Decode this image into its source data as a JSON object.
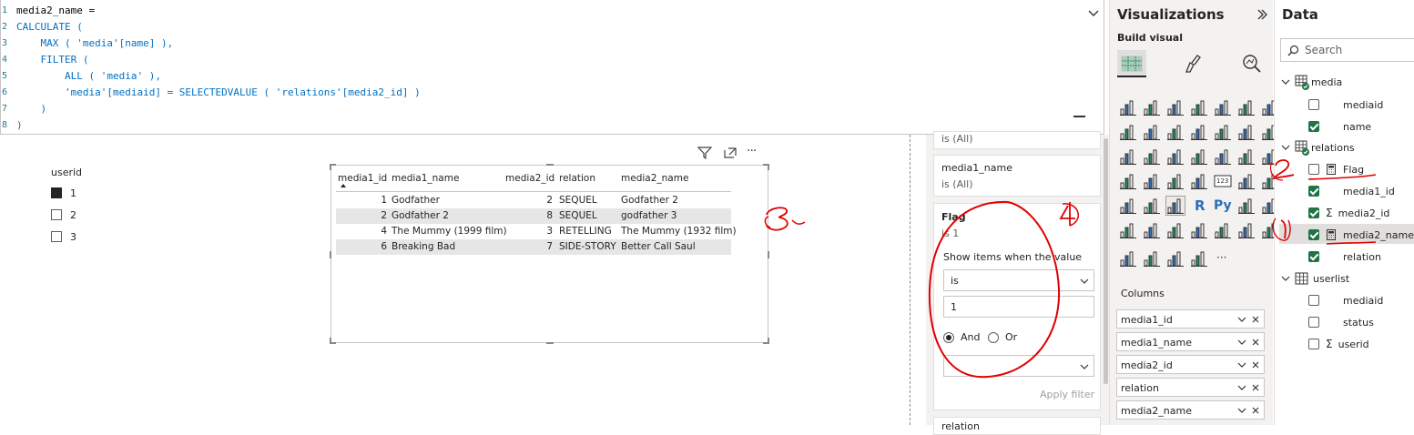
{
  "formula": {
    "lines": [
      {
        "n": "1",
        "text": "media2_name ="
      },
      {
        "n": "2",
        "text": "CALCULATE ("
      },
      {
        "n": "3",
        "text": "    MAX ( 'media'[name] ),"
      },
      {
        "n": "4",
        "text": "    FILTER ("
      },
      {
        "n": "5",
        "text": "        ALL ( 'media' ),"
      },
      {
        "n": "6",
        "text": "        'media'[mediaid] = SELECTEDVALUE ( 'relations'[media2_id] )"
      },
      {
        "n": "7",
        "text": "    )"
      },
      {
        "n": "8",
        "text": ")"
      }
    ]
  },
  "slicer": {
    "title": "userid",
    "items": [
      {
        "label": "1",
        "checked": true
      },
      {
        "label": "2",
        "checked": false
      },
      {
        "label": "3",
        "checked": false
      }
    ]
  },
  "table": {
    "headers": [
      "media1_id",
      "media1_name",
      "media2_id",
      "relation",
      "media2_name"
    ],
    "rows": [
      [
        "1",
        "Godfather",
        "2",
        "SEQUEL",
        "Godfather 2"
      ],
      [
        "2",
        "Godfather 2",
        "8",
        "SEQUEL",
        "godfather 3"
      ],
      [
        "4",
        "The Mummy (1999 film)",
        "3",
        "RETELLING",
        "The Mummy (1932 film)"
      ],
      [
        "6",
        "Breaking Bad",
        "7",
        "SIDE-STORY",
        "Better Call Saul"
      ]
    ]
  },
  "visual_tools": {
    "more": "···"
  },
  "filters": {
    "card_top_sub": "is (All)",
    "card_media1_title": "media1_name",
    "card_media1_sub": "is (All)",
    "flag_title": "Flag",
    "flag_sub": "is 1",
    "show_items_label": "Show items when the value",
    "condition": "is",
    "value": "1",
    "and_label": "And",
    "or_label": "Or",
    "apply_label": "Apply filter",
    "bottom_card_title": "relation"
  },
  "viz": {
    "title": "Visualizations",
    "build_label": "Build visual",
    "columns_label": "Columns",
    "wells": [
      "media1_id",
      "media1_name",
      "media2_id",
      "relation",
      "media2_name"
    ],
    "more_glyph": "···",
    "r_glyph": "R",
    "py_glyph": "Py",
    "num_glyph": "123"
  },
  "data": {
    "title": "Data",
    "search_placeholder": "Search",
    "tables": [
      {
        "name": "media",
        "fields": [
          "mediaid",
          "name"
        ]
      },
      {
        "name": "relations",
        "fields": [
          "Flag",
          "media1_id",
          "media2_id",
          "media2_name",
          "relation"
        ]
      },
      {
        "name": "userlist",
        "fields": [
          "mediaid",
          "status",
          "userid"
        ]
      }
    ]
  },
  "colors": {
    "accent_green": "#217346",
    "annotation_red": "#e00000",
    "row_shade": "#e6e6e6"
  }
}
